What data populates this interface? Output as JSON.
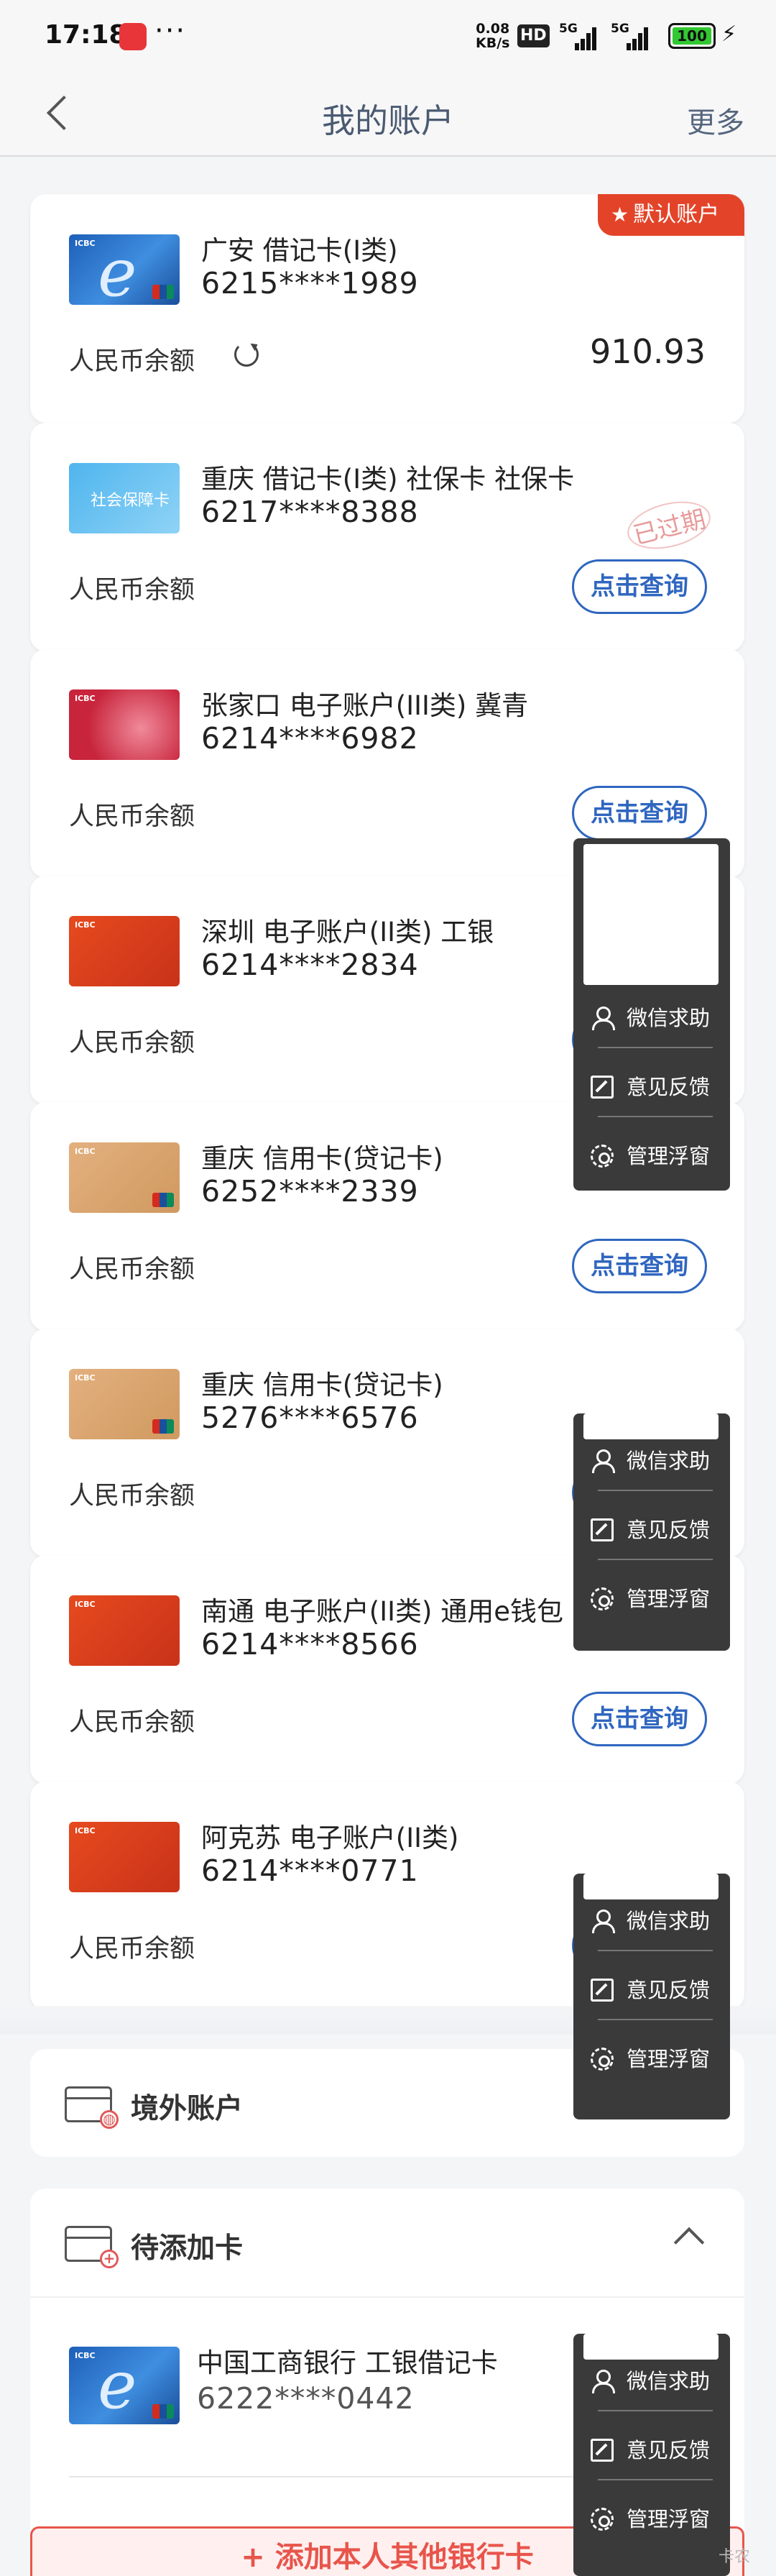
{
  "status_bar": {
    "time": "17:18",
    "dots": "···",
    "speed_value": "0.08",
    "speed_unit": "KB/s",
    "hd": "HD",
    "signal1": "5G",
    "signal2": "5G",
    "battery": "100"
  },
  "header": {
    "title": "我的账户",
    "more": "更多"
  },
  "balance_label": "人民币余额",
  "query_label": "点击查询",
  "accounts": [
    {
      "name": "广安 借记卡(I类)",
      "number": "6215****1989",
      "balance": "910.93",
      "default_tag": "默认账户"
    },
    {
      "name": "重庆 借记卡(I类)  社保卡 社保卡",
      "number": "6217****8388",
      "stamp": "已过期",
      "card_text": "社会保障卡"
    },
    {
      "name": "张家口 电子账户(III类) 冀青",
      "number": "6214****6982"
    },
    {
      "name": "深圳 电子账户(II类) 工银",
      "number": "6214****2834"
    },
    {
      "name": "重庆 信用卡(贷记卡)",
      "number": "6252****2339"
    },
    {
      "name": "重庆 信用卡(贷记卡)",
      "number": "5276****6576"
    },
    {
      "name": "南通 电子账户(II类) 通用e钱包",
      "number": "6214****8566"
    },
    {
      "name": "阿克苏 电子账户(II类)",
      "number": "6214****0771"
    }
  ],
  "float_menu": {
    "help": "微信求助",
    "feedback": "意见反馈",
    "manage": "管理浮窗"
  },
  "sections": {
    "overseas": "境外账户",
    "pending": "待添加卡"
  },
  "pending_card": {
    "name": "中国工商银行 工银借记卡",
    "number": "6222****0442"
  },
  "add_button": "+ 添加本人其他银行卡",
  "watermark": "卡农"
}
